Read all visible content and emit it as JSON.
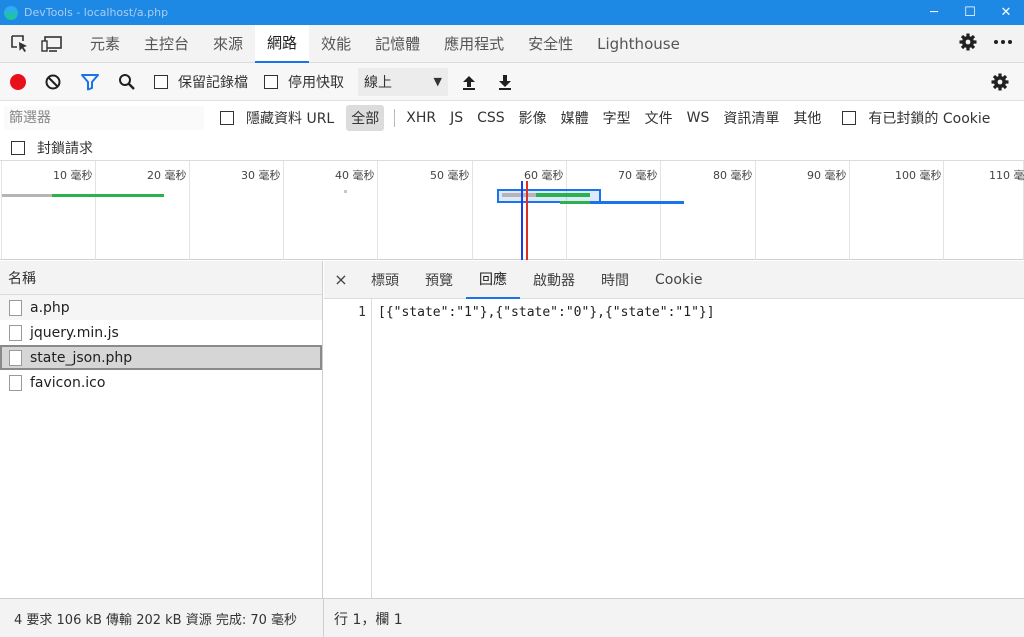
{
  "window": {
    "title": "DevTools - localhost/a.php",
    "controls": [
      "─",
      "☐",
      "✕"
    ]
  },
  "main_tabs": [
    {
      "label": "元素",
      "active": false
    },
    {
      "label": "主控台",
      "active": false
    },
    {
      "label": "來源",
      "active": false
    },
    {
      "label": "網路",
      "active": true
    },
    {
      "label": "效能",
      "active": false
    },
    {
      "label": "記憶體",
      "active": false
    },
    {
      "label": "應用程式",
      "active": false
    },
    {
      "label": "安全性",
      "active": false
    },
    {
      "label": "Lighthouse",
      "active": false
    }
  ],
  "toolbar": {
    "preserve_log_label": "保留記錄檔",
    "disable_cache_label": "停用快取",
    "throttle_value": "線上"
  },
  "filter": {
    "placeholder": "篩選器",
    "hide_data_urls_label": "隱藏資料 URL",
    "types": [
      "全部",
      "XHR",
      "JS",
      "CSS",
      "影像",
      "媒體",
      "字型",
      "文件",
      "WS",
      "資訊清單",
      "其他"
    ],
    "active_type": "全部",
    "blocked_cookies_label": "有已封鎖的 Cookie",
    "blocked_requests_label": "封鎖請求"
  },
  "timeline": {
    "ticks": [
      "10 毫秒",
      "20 毫秒",
      "30 毫秒",
      "40 毫秒",
      "50 毫秒",
      "60 毫秒",
      "70 毫秒",
      "80 毫秒",
      "90 毫秒",
      "100 毫秒",
      "110 毫秒"
    ]
  },
  "request_list": {
    "header": "名稱",
    "rows": [
      {
        "name": "a.php",
        "selected": false
      },
      {
        "name": "jquery.min.js",
        "selected": false
      },
      {
        "name": "state_json.php",
        "selected": true
      },
      {
        "name": "favicon.ico",
        "selected": false
      }
    ]
  },
  "detail": {
    "close": "×",
    "tabs": [
      "標頭",
      "預覽",
      "回應",
      "啟動器",
      "時間",
      "Cookie"
    ],
    "active_tab": "回應",
    "line_number": "1",
    "response_text": "[{\"state\":\"1\"},{\"state\":\"0\"},{\"state\":\"1\"}]"
  },
  "status": {
    "summary": "4 要求  106 kB 傳輸  202 kB 資源  完成: 70 毫秒",
    "cursor": "行 1，欄 1"
  },
  "colors": {
    "accent": "#1a73e8",
    "titlebar": "#1e88e5",
    "record": "#e8111b"
  }
}
